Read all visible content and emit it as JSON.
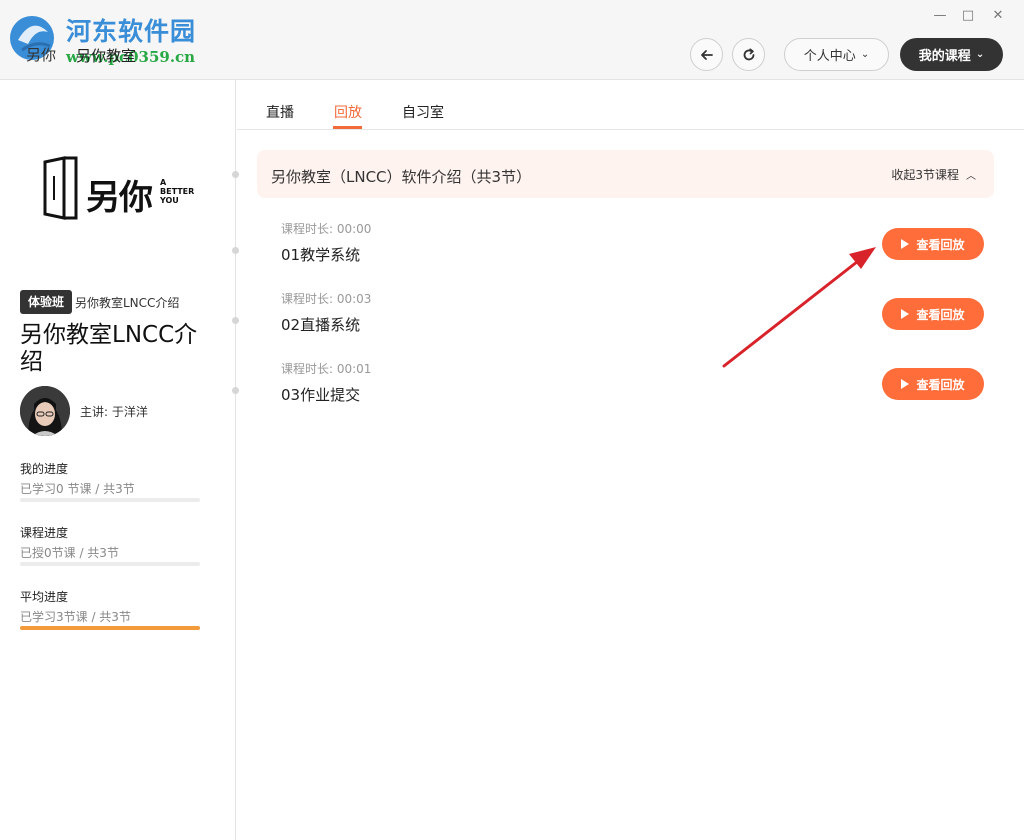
{
  "watermark": {
    "title": "河东软件园",
    "url": "www.pc0359.cn"
  },
  "app": {
    "logo_text": "另你",
    "name": "另你教室"
  },
  "window_controls": {
    "minimize": "—",
    "maximize": "□",
    "close": "✕"
  },
  "header": {
    "back_icon": "arrow-left-icon",
    "refresh_icon": "refresh-icon",
    "personal_center": "个人中心",
    "my_courses": "我的课程"
  },
  "sidebar": {
    "brand_main": "另你",
    "brand_sub": [
      "A",
      "BETTER",
      "YOU"
    ],
    "badge": "体验班",
    "badge_text": "另你教室LNCC介绍",
    "course_title": "另你教室LNCC介绍",
    "teacher": "主讲: 于洋洋",
    "progress": [
      {
        "label": "我的进度",
        "sub": "已学习0 节课 / 共3节",
        "fraction": 0.0
      },
      {
        "label": "课程进度",
        "sub": "已授0节课 / 共3节",
        "fraction": 0.0
      },
      {
        "label": "平均进度",
        "sub": "已学习3节课 / 共3节",
        "fraction": 1.0
      }
    ]
  },
  "tabs": [
    {
      "label": "直播",
      "active": false
    },
    {
      "label": "回放",
      "active": true
    },
    {
      "label": "自习室",
      "active": false
    }
  ],
  "group": {
    "title": "另你教室（LNCC）软件介绍（共3节）",
    "collapse_label": "收起3节课程"
  },
  "lessons": [
    {
      "duration": "课程时长: 00:00",
      "name": "01教学系统",
      "button": "查看回放"
    },
    {
      "duration": "课程时长: 00:03",
      "name": "02直播系统",
      "button": "查看回放"
    },
    {
      "duration": "课程时长: 00:01",
      "name": "03作业提交",
      "button": "查看回放"
    }
  ],
  "colors": {
    "accent": "#f26b3a",
    "button": "#ff6d3a",
    "progress": "#f39a3a",
    "arrow": "#d8232a"
  }
}
